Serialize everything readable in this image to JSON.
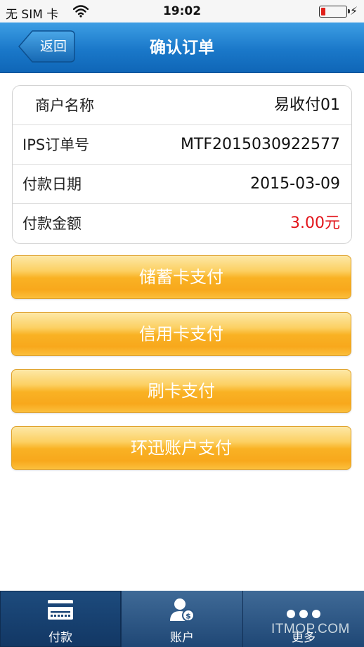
{
  "status_bar": {
    "carrier": "无 SIM 卡",
    "time": "19:02"
  },
  "nav": {
    "back_label": "返回",
    "title": "确认订单"
  },
  "order": {
    "rows": [
      {
        "label": "商户名称",
        "value": "易收付01"
      },
      {
        "label": "IPS订单号",
        "value": "MTF2015030922577"
      },
      {
        "label": "付款日期",
        "value": "2015-03-09"
      },
      {
        "label": "付款金额",
        "value": "3.00元"
      }
    ]
  },
  "payment_options": [
    {
      "label": "储蓄卡支付"
    },
    {
      "label": "信用卡支付"
    },
    {
      "label": "刷卡支付"
    },
    {
      "label": "环迅账户支付"
    }
  ],
  "tabs": [
    {
      "label": "付款",
      "icon": "card-reader-icon",
      "active": true
    },
    {
      "label": "账户",
      "icon": "account-icon",
      "active": false
    },
    {
      "label": "更多",
      "icon": "more-icon",
      "active": false
    }
  ],
  "watermark": "ITMOP.COM",
  "colors": {
    "nav_blue": "#1a78c9",
    "button_orange": "#f9b224",
    "amount_red": "#e2141a",
    "tab_bar": "#1f4775"
  }
}
